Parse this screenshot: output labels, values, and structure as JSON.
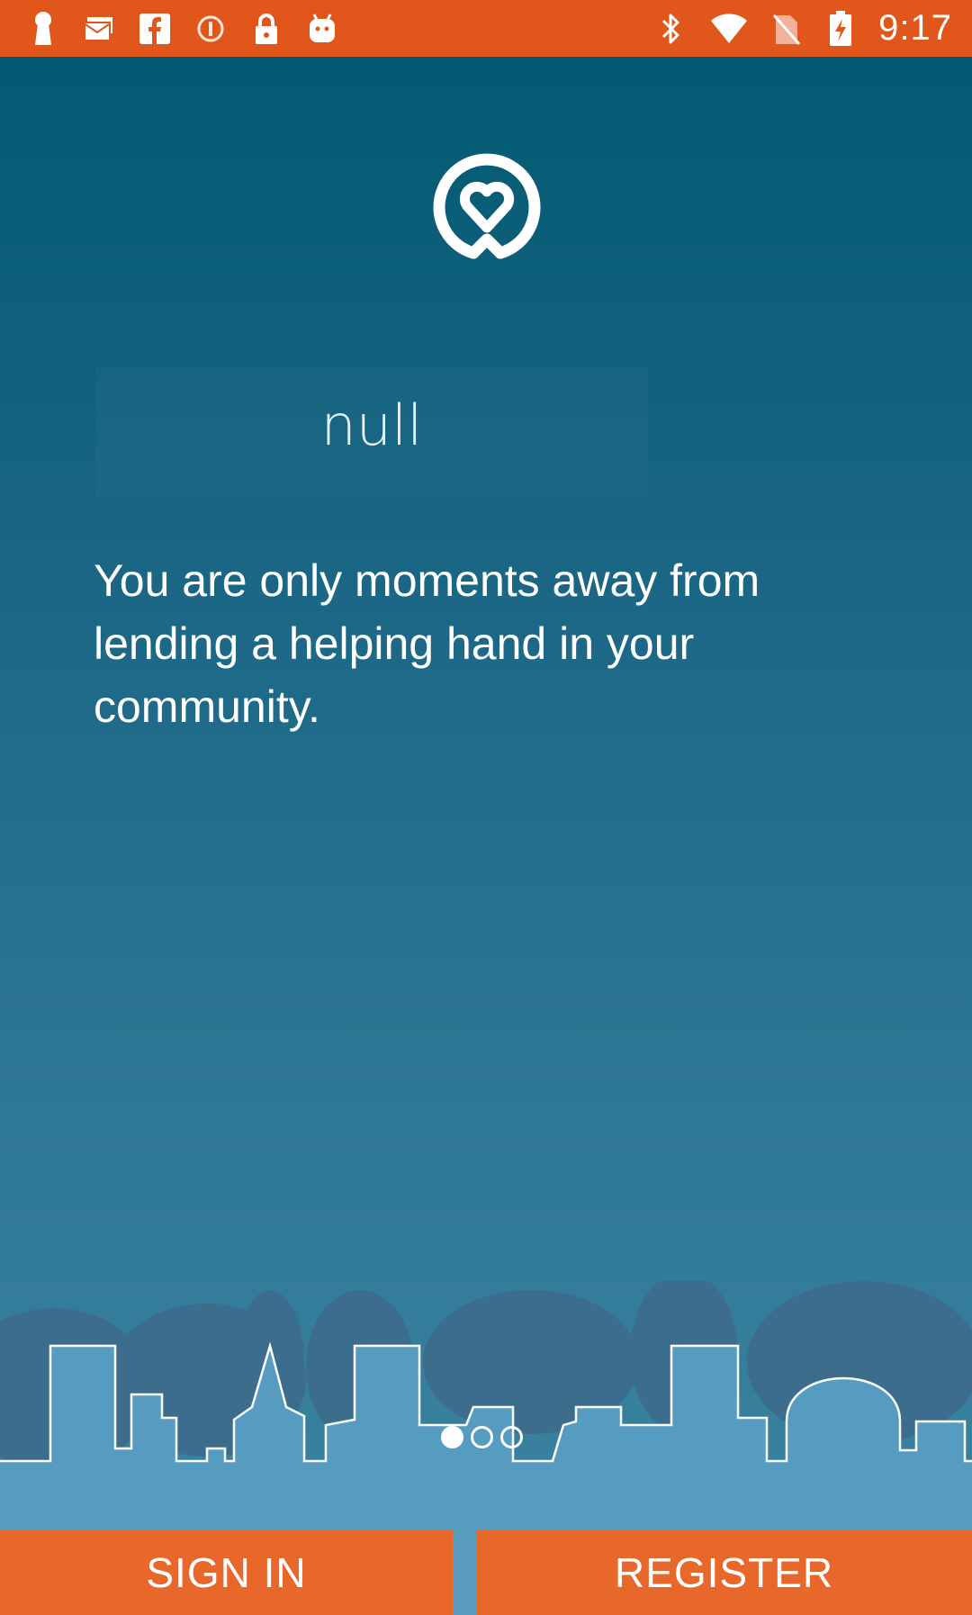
{
  "status_bar": {
    "time": "9:17",
    "left_icons": [
      "keyhole-icon",
      "mail-icon",
      "facebook-icon",
      "alert-circle-icon",
      "lock-icon",
      "android-icon"
    ],
    "right_icons": [
      "bluetooth-icon",
      "wifi-icon",
      "no-sim-icon",
      "battery-charging-icon"
    ],
    "color": "#e1561a"
  },
  "main": {
    "logo_icon": "heart-pin-icon",
    "org_name": "null",
    "tagline": "You are only moments away from lending a helping hand in your community."
  },
  "pager": {
    "count": 3,
    "active_index": 0
  },
  "actions": {
    "sign_in_label": "SIGN IN",
    "register_label": "REGISTER",
    "button_color": "#e8672a"
  }
}
